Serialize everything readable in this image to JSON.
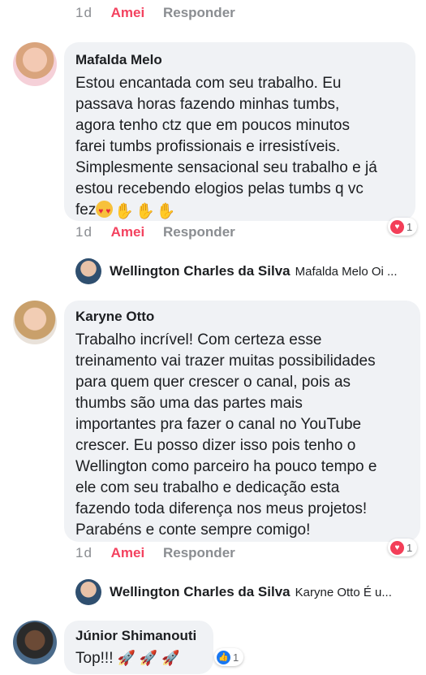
{
  "comments": [
    {
      "actions": {
        "time": "1d",
        "liked": "Amei",
        "reply": "Responder"
      }
    },
    {
      "author": "Mafalda Melo",
      "text": "Estou encantada com seu trabalho. Eu\npassava horas fazendo minhas tumbs,\nagora tenho ctz que em poucos minutos\nfarei tumbs profissionais e irresistíveis.\nSimplesmente sensacional seu trabalho e já\nestou recebendo elogios pelas tumbs q vc\nfez",
      "reaction_count": "1",
      "actions": {
        "time": "1d",
        "liked": "Amei",
        "reply": "Responder"
      },
      "reply": {
        "author": "Wellington Charles da Silva",
        "preview": "Mafalda Melo Oi ..."
      }
    },
    {
      "author": "Karyne Otto",
      "text": "Trabalho incrível! Com certeza esse\ntreinamento vai trazer muitas possibilidades\npara quem quer crescer o canal, pois as\nthumbs são uma das partes mais\nimportantes pra fazer o canal no YouTube\ncrescer. Eu posso dizer isso pois tenho o\nWellington como parceiro ha pouco tempo e\nele com seu trabalho e dedicação esta\nfazendo toda diferença nos meus projetos!\nParabéns e conte sempre comigo!",
      "reaction_count": "1",
      "actions": {
        "time": "1d",
        "liked": "Amei",
        "reply": "Responder"
      },
      "reply": {
        "author": "Wellington Charles da Silva",
        "preview": "Karyne Otto É u..."
      }
    },
    {
      "author": "Júnior Shimanouti",
      "text": "Top!!!",
      "reaction_count": "1"
    }
  ],
  "colors": {
    "liked": "#f3425f",
    "bubble": "#f0f2f5",
    "heart": "#f33e58",
    "like": "#1877f2"
  }
}
